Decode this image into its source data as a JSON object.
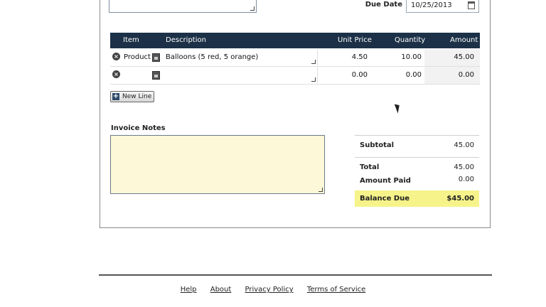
{
  "due_date": {
    "label": "Due Date",
    "value": "10/25/2013"
  },
  "table": {
    "headers": {
      "item": "Item",
      "description": "Description",
      "unit_price": "Unit Price",
      "quantity": "Quantity",
      "amount": "Amount"
    },
    "rows": [
      {
        "item": "Product",
        "description": "Balloons (5 red, 5 orange)",
        "unit_price": "4.50",
        "quantity": "10.00",
        "amount": "45.00"
      },
      {
        "item": "",
        "description": "",
        "unit_price": "0.00",
        "quantity": "0.00",
        "amount": "0.00"
      }
    ]
  },
  "new_line_label": "New Line",
  "notes": {
    "label": "Invoice Notes",
    "value": ""
  },
  "totals": {
    "subtotal_label": "Subtotal",
    "subtotal": "45.00",
    "total_label": "Total",
    "total": "45.00",
    "amount_paid_label": "Amount Paid",
    "amount_paid": "0.00",
    "balance_due_label": "Balance Due",
    "balance_due": "$45.00"
  },
  "footer": {
    "links": [
      "Help",
      "About",
      "Privacy Policy",
      "Terms of Service"
    ]
  },
  "colors": {
    "header_bg": "#1c3147",
    "notes_bg": "#fdf8d8",
    "balance_bg": "#f6f38a"
  }
}
